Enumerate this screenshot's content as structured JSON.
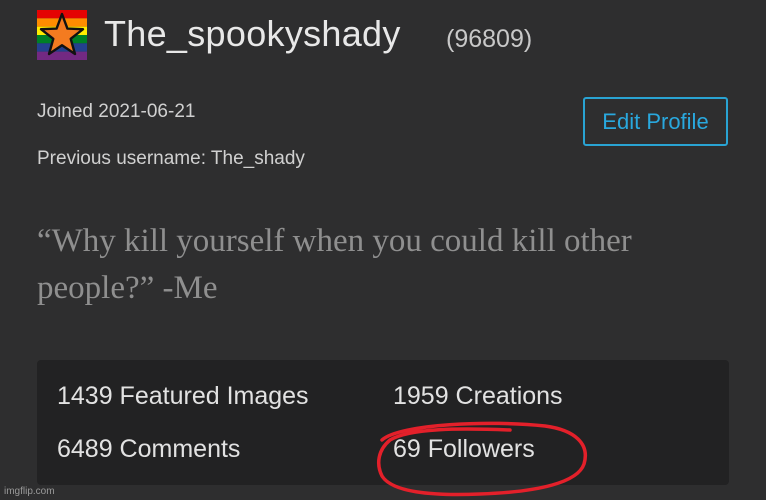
{
  "profile": {
    "username": "The_spookyshady",
    "user_id": "(96809)",
    "joined": "Joined 2021-06-21",
    "previous_username": "Previous username: The_shady",
    "edit_label": "Edit Profile",
    "bio": "“Why kill yourself when you could kill other people?” -Me"
  },
  "stats": {
    "featured_images": "1439 Featured Images",
    "creations": "1959 Creations",
    "comments": "6489 Comments",
    "followers": "69 Followers"
  },
  "icons": {
    "avatar": "rainbow-flag-star-icon"
  },
  "colors": {
    "background": "#2e2e2f",
    "stats_panel": "#222223",
    "accent": "#29a8de",
    "annotation": "#e3202a"
  },
  "watermark": "imgflip.com"
}
